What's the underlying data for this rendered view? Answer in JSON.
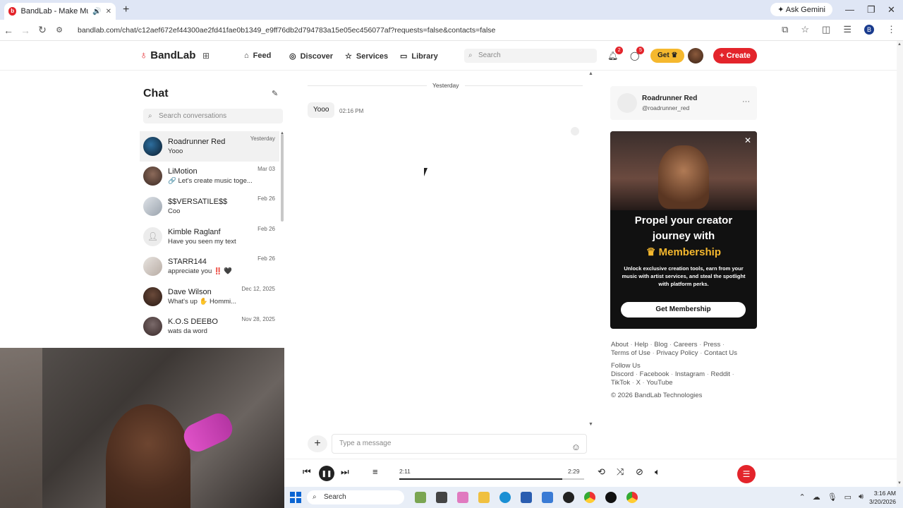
{
  "browser": {
    "tab_title": "BandLab - Make Music Onl",
    "new_tab": "+",
    "ask_gemini": "Ask Gemini",
    "url": "bandlab.com/chat/c12aef672ef44300ae2fd41fae0b1349_e9ff76db2d794783a15e05ec456077af?requests=false&contacts=false",
    "profile_initial": "B"
  },
  "nav": {
    "logo": "BandLab",
    "links": [
      "Feed",
      "Discover",
      "Services",
      "Library"
    ],
    "search_placeholder": "Search",
    "notifications_count": "2",
    "messages_count": "5",
    "get_label": "Get",
    "create_label": "Create"
  },
  "chat": {
    "title": "Chat",
    "search_placeholder": "Search conversations",
    "conversations": [
      {
        "name": "Roadrunner Red",
        "message": "Yooo",
        "date": "Yesterday"
      },
      {
        "name": "LiMotion",
        "message": "🔗 Let's create music toge...",
        "date": "Mar 03"
      },
      {
        "name": "$$VERSATILE$$",
        "message": "Coo",
        "date": "Feb 26"
      },
      {
        "name": "Kimble Raglanf",
        "message": "Have you seen my text",
        "date": "Feb 26"
      },
      {
        "name": "STARR144",
        "message": "appreciate you ‼️ 🖤",
        "date": "Feb 26"
      },
      {
        "name": "Dave Wilson",
        "message": "What's up ✋ Hommi...",
        "date": "Dec 12, 2025"
      },
      {
        "name": "K.O.S DEEBO",
        "message": "wats da word",
        "date": "Nov 28, 2025"
      }
    ]
  },
  "thread": {
    "day_label": "Yesterday",
    "message_text": "Yooo",
    "message_time": "02:16 PM",
    "input_placeholder": "Type a message"
  },
  "profile": {
    "name": "Roadrunner Red",
    "handle": "@roadrunner_red"
  },
  "ad": {
    "line1": "Propel your creator",
    "line2": "journey with",
    "line3": "Membership",
    "description": "Unlock exclusive creation tools, earn from your music with artist services, and steal the spotlight with platform perks.",
    "cta": "Get Membership"
  },
  "footer": {
    "row1": [
      "About",
      "Help",
      "Blog",
      "Careers",
      "Press"
    ],
    "row2": [
      "Terms of Use",
      "Privacy Policy",
      "Contact Us"
    ],
    "follow_label": "Follow Us",
    "row3": [
      "Discord",
      "Facebook",
      "Instagram",
      "Reddit"
    ],
    "row4": [
      "TikTok",
      "X",
      "YouTube"
    ],
    "copyright": "© 2026 BandLab Technologies"
  },
  "player": {
    "current_time": "2:11",
    "duration": "2:29",
    "progress_fraction": 0.88
  },
  "taskbar": {
    "search_label": "Search",
    "time": "3:16 AM",
    "date": "3/20/2026"
  },
  "colors": {
    "brand": "#e3242b",
    "gold": "#f5b82e"
  }
}
